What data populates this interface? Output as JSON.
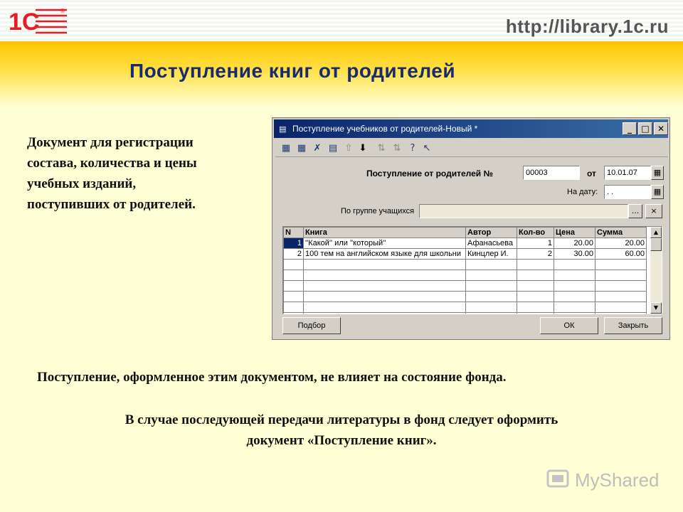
{
  "header": {
    "logo_text": "1С",
    "url": "http://library.1c.ru",
    "title": "Поступление книг от родителей"
  },
  "description": "Документ для регистрации\nсостава,  количества и цены\nучебных изданий,\nпоступивших от родителей.",
  "window": {
    "title": "Поступление учебников от родителей-Новый *",
    "doc_label": "Поступление от родителей №",
    "doc_number": "00003",
    "date_from_label": "от",
    "date": "10.01.07",
    "on_date_label": "На дату:",
    "on_date_value": " .  .",
    "group_label": "По группе учащихся",
    "group_value": "",
    "browse_icon": "...",
    "clear_icon": "×",
    "table": {
      "columns": [
        "N",
        "Книга",
        "Автор",
        "Кол-во",
        "Цена",
        "Сумма"
      ],
      "rows": [
        [
          "1",
          "''Какой'' или ''который''",
          "Афанасьева",
          "1",
          "20.00",
          "20.00"
        ],
        [
          "2",
          "100 тем на английском языке для школьни",
          "Кинцлер И.",
          "2",
          "30.00",
          "60.00"
        ]
      ]
    },
    "buttons": {
      "select": "Подбор",
      "ok": "ОК",
      "close": "Закрыть"
    }
  },
  "notes": {
    "note1": "Поступление, оформленное этим документом, не влияет на состояние фонда.",
    "note2": "В случае последующей передачи литературы в фонд следует оформить\nдокумент «Поступление книг»."
  },
  "watermark": "MyShared",
  "colors": {
    "accent_title": "#1A2A6C",
    "window_title": "#0A246A",
    "logo_red": "#E31E24"
  }
}
